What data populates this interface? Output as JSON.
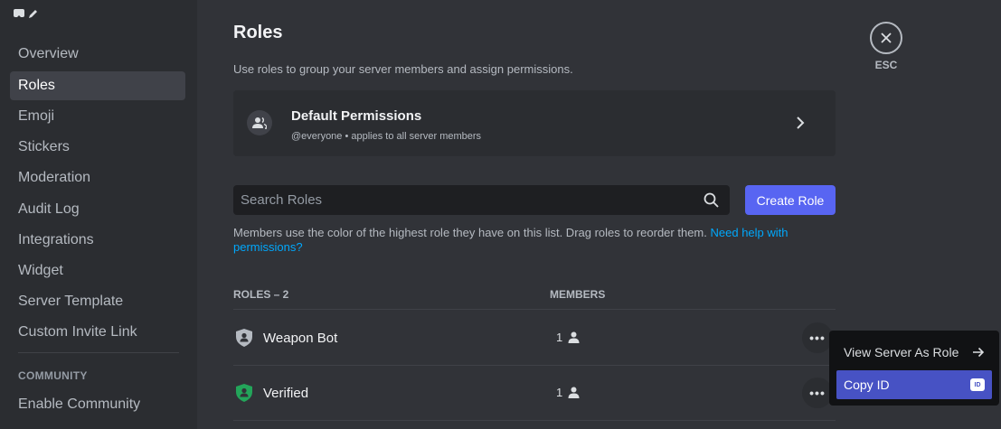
{
  "sidebar": {
    "items": [
      {
        "label": "Overview"
      },
      {
        "label": "Roles",
        "active": true
      },
      {
        "label": "Emoji"
      },
      {
        "label": "Stickers"
      },
      {
        "label": "Moderation"
      },
      {
        "label": "Audit Log"
      },
      {
        "label": "Integrations"
      },
      {
        "label": "Widget"
      },
      {
        "label": "Server Template"
      },
      {
        "label": "Custom Invite Link"
      }
    ],
    "community_header": "COMMUNITY",
    "community_items": [
      {
        "label": "Enable Community"
      }
    ]
  },
  "main": {
    "title": "Roles",
    "description": "Use roles to group your server members and assign permissions.",
    "default_permissions": {
      "title": "Default Permissions",
      "subtitle": "@everyone • applies to all server members"
    },
    "search": {
      "placeholder": "Search Roles"
    },
    "create_role_label": "Create Role",
    "help_text": "Members use the color of the highest role they have on this list. Drag roles to reorder them.",
    "help_link": "Need help with permissions?",
    "columns": {
      "roles": "ROLES – 2",
      "members": "MEMBERS"
    },
    "roles": [
      {
        "name": "Weapon Bot",
        "members": "1",
        "color": "#b5bac1"
      },
      {
        "name": "Verified",
        "members": "1",
        "color": "#23a55a"
      }
    ],
    "more_label": "•••"
  },
  "close": {
    "label": "ESC"
  },
  "context_menu": {
    "items": [
      {
        "label": "View Server As Role"
      },
      {
        "label": "Copy ID",
        "badge": "ID",
        "hover": true
      }
    ]
  },
  "colors": {
    "accent": "#5865f2",
    "link": "#00a8fc",
    "menu_hover": "#4752c4"
  }
}
